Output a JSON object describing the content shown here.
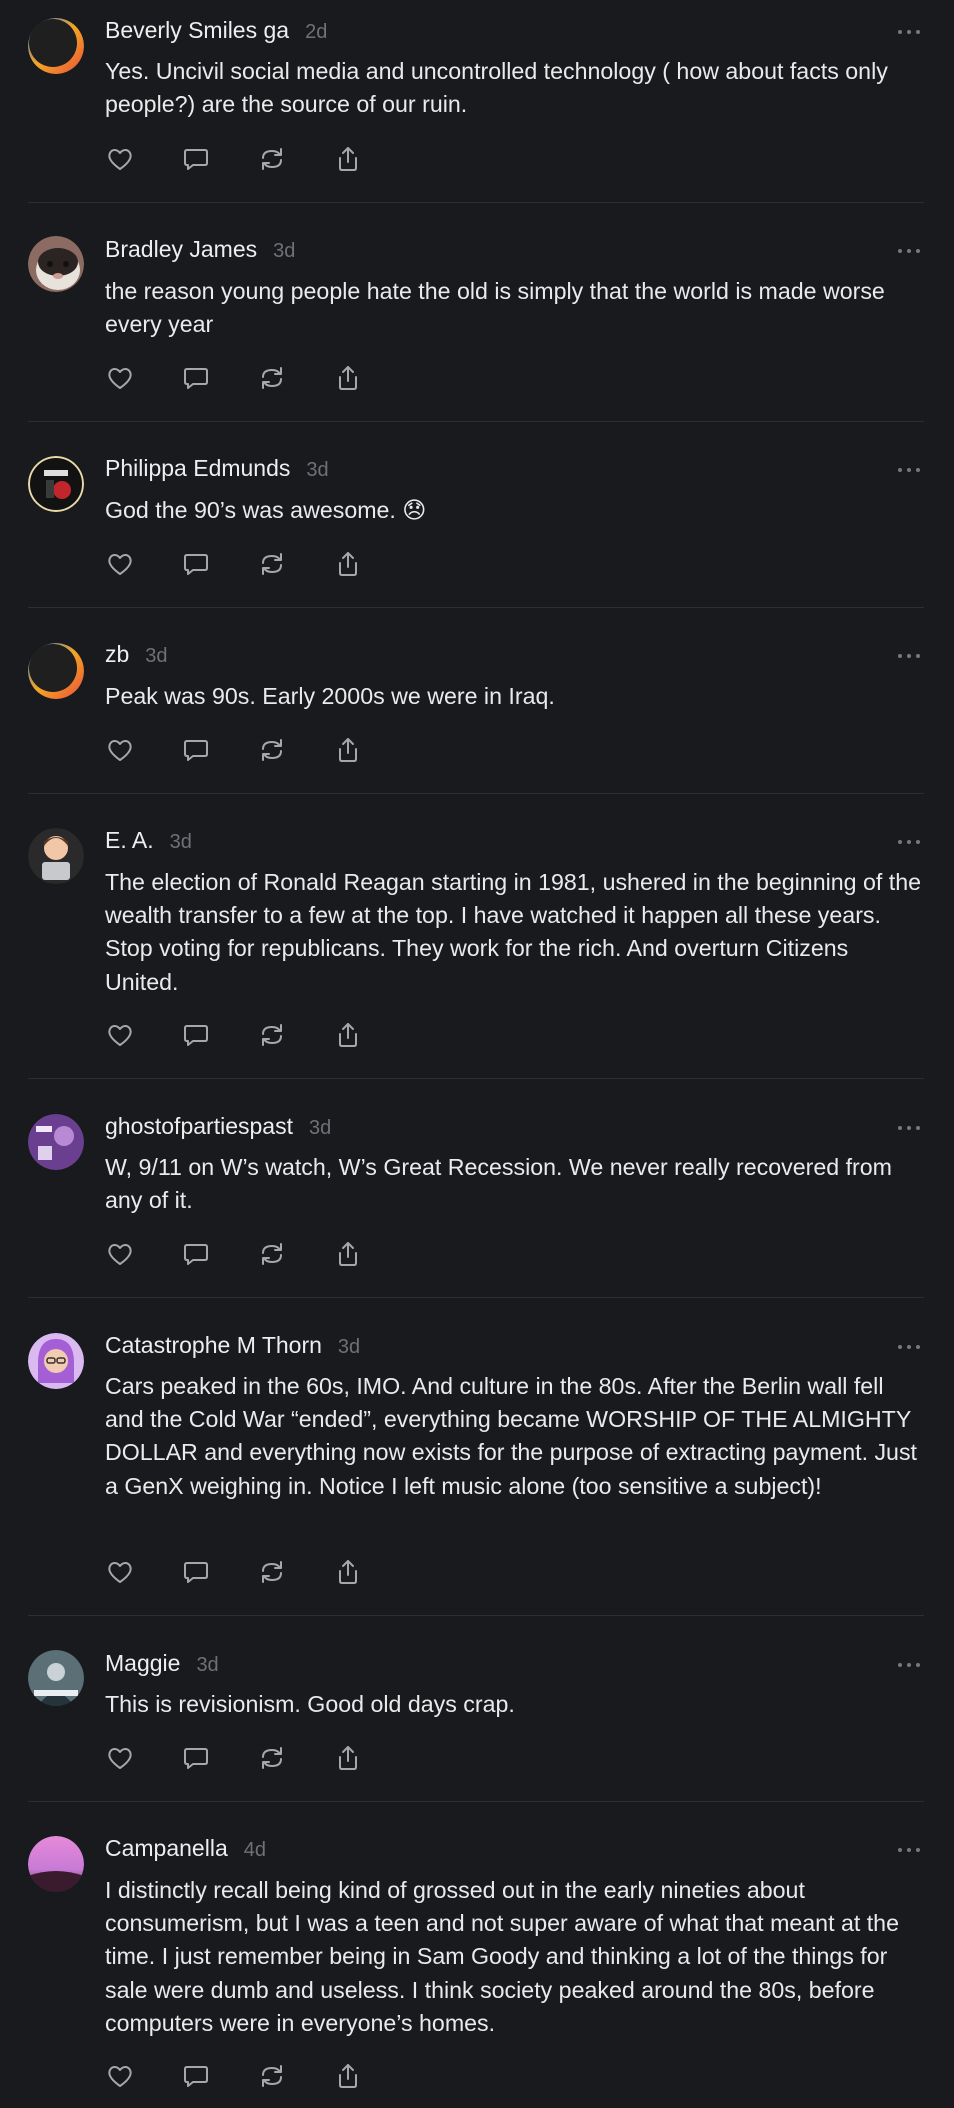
{
  "feed": {
    "posts": [
      {
        "author": "Beverly Smiles ga",
        "time": "2d",
        "text": "Yes. Uncivil social media and uncontrolled technology ( how about facts only people?) are the source of our ruin.",
        "avatar": "swirl-avatar"
      },
      {
        "author": "Bradley James",
        "time": "3d",
        "text": "the reason young people hate the old is simply that the world is made worse every year",
        "avatar": "cat-avatar"
      },
      {
        "author": "Philippa Edmunds",
        "time": "3d",
        "text": "God the 90’s was awesome. 😞",
        "avatar": "poster-avatar"
      },
      {
        "author": "zb",
        "time": "3d",
        "text": "Peak was 90s. Early 2000s we were in Iraq.",
        "avatar": "swirl-avatar"
      },
      {
        "author": "E. A.",
        "time": "3d",
        "text": "The election of Ronald Reagan starting in 1981, ushered in the beginning of the wealth transfer to a few at the top. I have watched it happen all these years. Stop voting for republicans. They work for the rich. And overturn Citizens United.",
        "avatar": "memoji-avatar"
      },
      {
        "author": "ghostofpartiespast",
        "time": "3d",
        "text": "W, 9/11 on W’s watch, W’s Great Recession. We never really recovered from any of it.",
        "avatar": "purple-avatar"
      },
      {
        "author": "Catastrophe M Thorn",
        "time": "3d",
        "text": "Cars peaked in the 60s, IMO. And culture in the 80s. After the Berlin wall fell and the Cold War “ended”, everything became WORSHIP OF THE ALMIGHTY DOLLAR and everything now exists for the purpose of extracting payment. Just a GenX weighing in. Notice I left music alone (too sensitive a subject)!",
        "avatar": "purple-hair-avatar"
      },
      {
        "author": "Maggie",
        "time": "3d",
        "text": "This is revisionism. Good old days crap.",
        "avatar": "photo-avatar"
      },
      {
        "author": "Campanella",
        "time": "4d",
        "text": "I distinctly recall being kind of grossed out in the early nineties about consumerism, but I was a teen and not super aware of what that meant at the time. I just remember being in Sam Goody and thinking a lot of the things for sale were dumb and useless. I think society peaked around the 80s, before computers were in everyone’s homes.",
        "avatar": "sunset-avatar"
      }
    ]
  },
  "icons": {
    "like": "heart-icon",
    "reply": "comment-icon",
    "repost": "repost-icon",
    "share": "share-icon",
    "more": "more-icon"
  },
  "colors": {
    "background": "#181a1d",
    "text": "#eaeaeb",
    "muted": "#6f7176",
    "icon": "#a5a7ab",
    "divider": "#2c2e32"
  }
}
